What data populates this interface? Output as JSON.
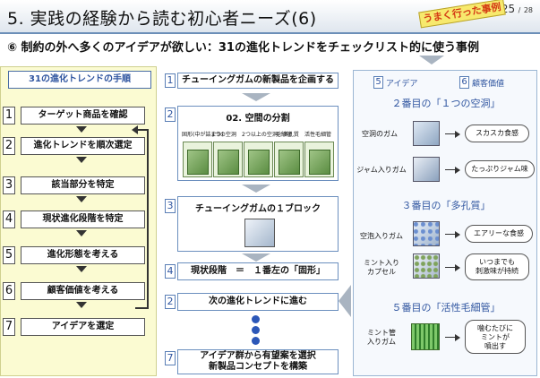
{
  "header": {
    "title": "5. 実践の経験から読む初心者ニーズ(6)",
    "page_current": "25",
    "page_sep": "/",
    "page_total": "28",
    "stamp": "うまく行った事例",
    "subtitle": "⑥ 制約の外へ多くのアイデアが欲しい：31の進化トレンドをチェックリスト的に使う事例"
  },
  "procedure": {
    "heading": "31の進化トレンドの手順",
    "steps": [
      {
        "num": "1",
        "label": "ターゲット商品を確認"
      },
      {
        "num": "2",
        "label": "進化トレンドを順次選定"
      },
      {
        "num": "3",
        "label": "該当部分を特定"
      },
      {
        "num": "4",
        "label": "現状進化段階を特定"
      },
      {
        "num": "5",
        "label": "進化形態を考える"
      },
      {
        "num": "6",
        "label": "顧客価値を考える"
      },
      {
        "num": "7",
        "label": "アイデアを選定"
      }
    ]
  },
  "middle": {
    "step1": {
      "num": "1",
      "label": "チューイングガムの新製品を企画する"
    },
    "step2": {
      "num": "2",
      "label": "02. 空間の分割",
      "cubes": [
        "固形(中が詰まり)",
        "1つの空洞",
        "2つ以上の空洞／多孔質",
        "毛細管",
        "活性毛細管"
      ]
    },
    "step3": {
      "num": "3",
      "label": "チューイングガムの１ブロック"
    },
    "step4": {
      "num": "4",
      "label": "現状段階　＝　１番左の「固形」"
    },
    "step2b": {
      "num": "2",
      "label": "次の進化トレンドに進む"
    },
    "step7": {
      "num": "7",
      "label": "アイデア群から有望案を選択\n新製品コンセプトを構築"
    }
  },
  "right": {
    "hdr": [
      {
        "num": "5",
        "label": "アイデア"
      },
      {
        "num": "6",
        "label": "顧客価値"
      }
    ],
    "sections": [
      {
        "title": "２番目の「１つの空洞」",
        "rows": [
          {
            "idea": "空洞のガム",
            "value": "スカスカ食感"
          },
          {
            "idea": "ジャム入りガム",
            "value": "たっぷりジャム味"
          }
        ]
      },
      {
        "title": "３番目の「多孔質」",
        "rows": [
          {
            "idea": "空泡入りガム",
            "value": "エアリーな食感"
          },
          {
            "idea": "ミント入り\nカプセル",
            "value": "いつまでも\n刺激味が持続"
          }
        ]
      },
      {
        "title": "５番目の「活性毛細管」",
        "rows": [
          {
            "idea": "ミント管\n入りガム",
            "value": "噛むたびに\nミントが\n噴出す"
          }
        ]
      }
    ]
  }
}
